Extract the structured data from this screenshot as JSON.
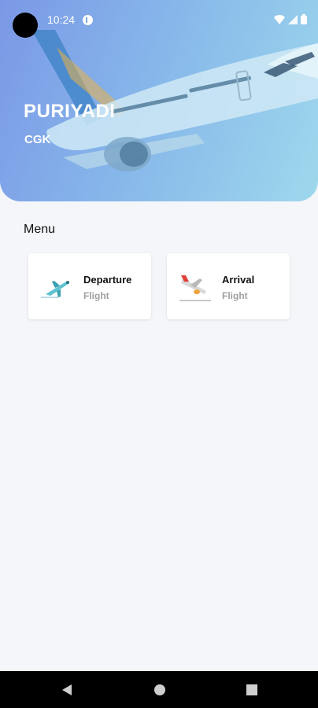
{
  "status_bar": {
    "time": "10:24",
    "icons": [
      "app-notification-icon",
      "wifi-icon",
      "signal-icon",
      "battery-icon"
    ]
  },
  "header": {
    "title": "PURIYADI",
    "subtitle": "CGK",
    "background_image": "airplane-photo",
    "gradient_colors": [
      "#7b98e6",
      "#9ed8ec"
    ]
  },
  "menu": {
    "heading": "Menu",
    "items": [
      {
        "title": "Departure",
        "subtitle": "Flight",
        "icon": "departure-plane-icon"
      },
      {
        "title": "Arrival",
        "subtitle": "Flight",
        "icon": "arrival-plane-icon"
      }
    ]
  },
  "nav_bar": {
    "buttons": [
      "back-icon",
      "home-icon",
      "recents-icon"
    ]
  }
}
